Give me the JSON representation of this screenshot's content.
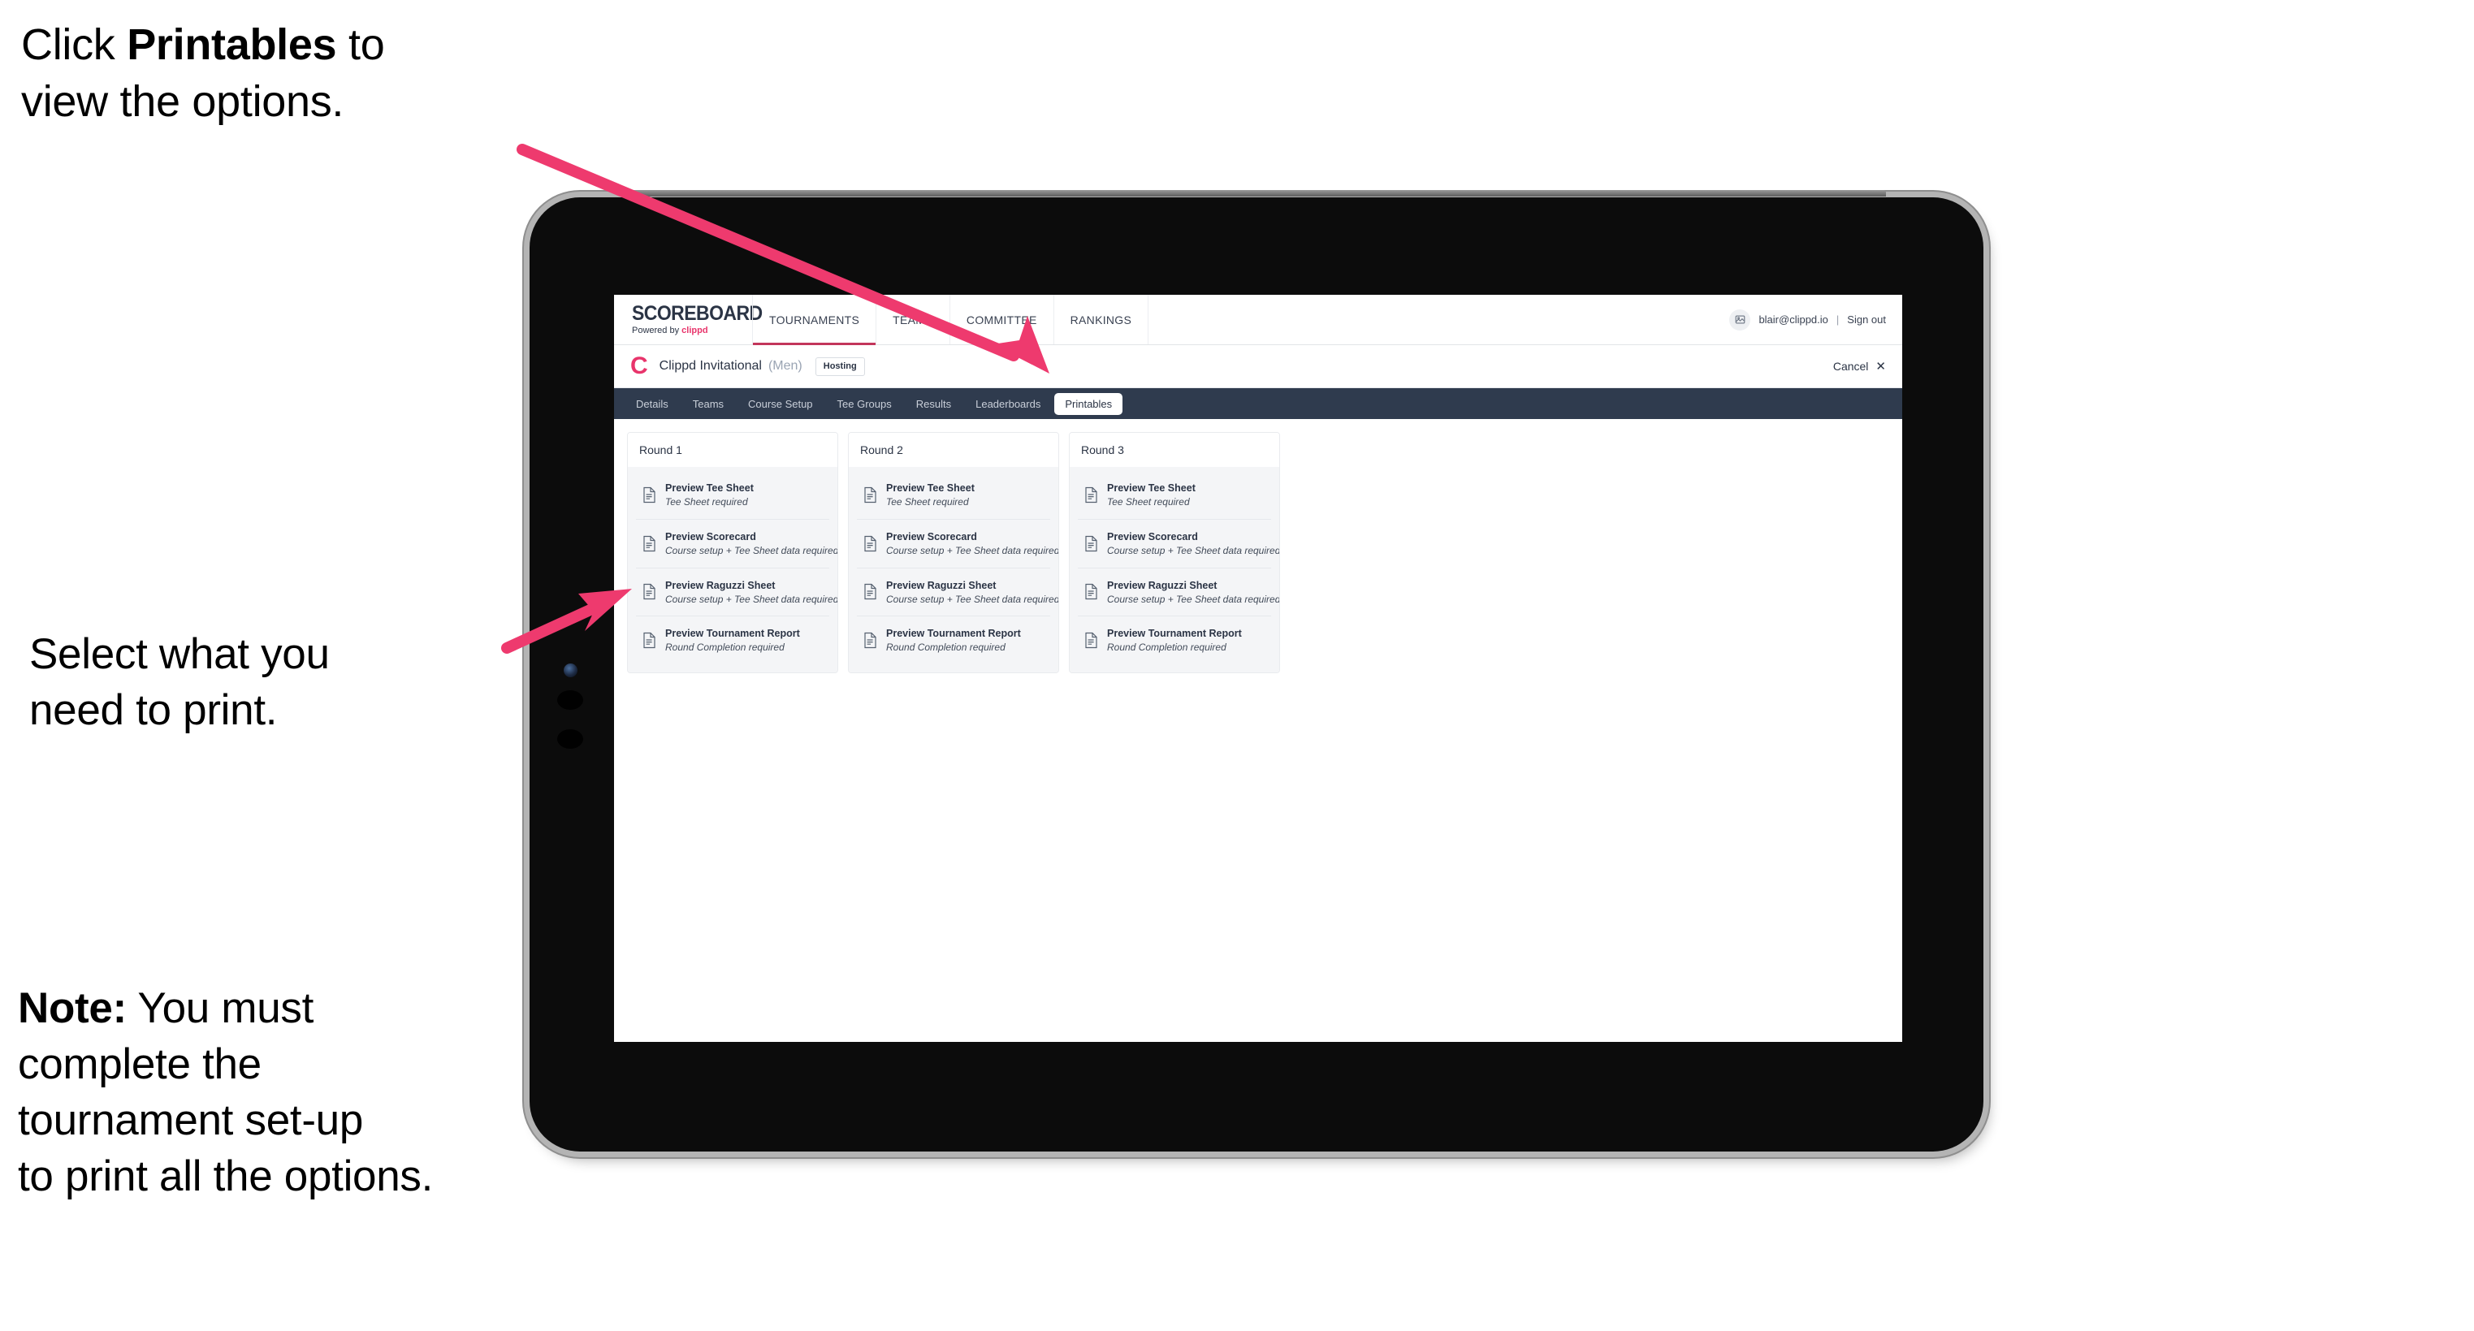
{
  "annotations": {
    "click_line1_pre": "Click ",
    "click_bold": "Printables",
    "click_line1_post": " to",
    "click_line2": "view the options.",
    "select_line1": "Select what you",
    "select_line2": "need to print.",
    "note_bold": "Note:",
    "note_line1_rest": " You must",
    "note_line2": "complete the",
    "note_line3": "tournament set-up",
    "note_line4": "to print all the options."
  },
  "topnav": {
    "brand_title": "SCOREBOARD",
    "brand_sub_prefix": "Powered by ",
    "brand_sub_name": "clippd",
    "links": [
      {
        "label": "TOURNAMENTS",
        "active": true
      },
      {
        "label": "TEAMS",
        "active": false
      },
      {
        "label": "COMMITTEE",
        "active": false
      },
      {
        "label": "RANKINGS",
        "active": false
      }
    ],
    "user_email": "blair@clippd.io",
    "separator": "|",
    "sign_out": "Sign out"
  },
  "tournament": {
    "logo_letter": "C",
    "name": "Clippd Invitational",
    "gender": "(Men)",
    "status_badge": "Hosting",
    "cancel_label": "Cancel",
    "cancel_x": "✕"
  },
  "tabs": [
    {
      "label": "Details",
      "active": false
    },
    {
      "label": "Teams",
      "active": false
    },
    {
      "label": "Course Setup",
      "active": false
    },
    {
      "label": "Tee Groups",
      "active": false
    },
    {
      "label": "Results",
      "active": false
    },
    {
      "label": "Leaderboards",
      "active": false
    },
    {
      "label": "Printables",
      "active": true
    }
  ],
  "rounds": [
    {
      "title": "Round 1",
      "items": [
        {
          "title": "Preview Tee Sheet",
          "sub": "Tee Sheet required",
          "icon": "document-icon"
        },
        {
          "title": "Preview Scorecard",
          "sub": "Course setup + Tee Sheet data required",
          "icon": "document-icon"
        },
        {
          "title": "Preview Raguzzi Sheet",
          "sub": "Course setup + Tee Sheet data required",
          "icon": "document-icon"
        },
        {
          "title": "Preview Tournament Report",
          "sub": "Round Completion required",
          "icon": "document-icon"
        }
      ]
    },
    {
      "title": "Round 2",
      "items": [
        {
          "title": "Preview Tee Sheet",
          "sub": "Tee Sheet required",
          "icon": "document-icon"
        },
        {
          "title": "Preview Scorecard",
          "sub": "Course setup + Tee Sheet data required",
          "icon": "document-icon"
        },
        {
          "title": "Preview Raguzzi Sheet",
          "sub": "Course setup + Tee Sheet data required",
          "icon": "document-icon"
        },
        {
          "title": "Preview Tournament Report",
          "sub": "Round Completion required",
          "icon": "document-icon"
        }
      ]
    },
    {
      "title": "Round 3",
      "items": [
        {
          "title": "Preview Tee Sheet",
          "sub": "Tee Sheet required",
          "icon": "document-icon"
        },
        {
          "title": "Preview Scorecard",
          "sub": "Course setup + Tee Sheet data required",
          "icon": "document-icon"
        },
        {
          "title": "Preview Raguzzi Sheet",
          "sub": "Course setup + Tee Sheet data required",
          "icon": "document-icon"
        },
        {
          "title": "Preview Tournament Report",
          "sub": "Round Completion required",
          "icon": "document-icon"
        }
      ]
    }
  ],
  "colors": {
    "accent_pink": "#ee3a6e",
    "brand_pink": "#e8346b",
    "tabbar_navy": "#2f3b4e",
    "text_dark": "#2b3445"
  }
}
